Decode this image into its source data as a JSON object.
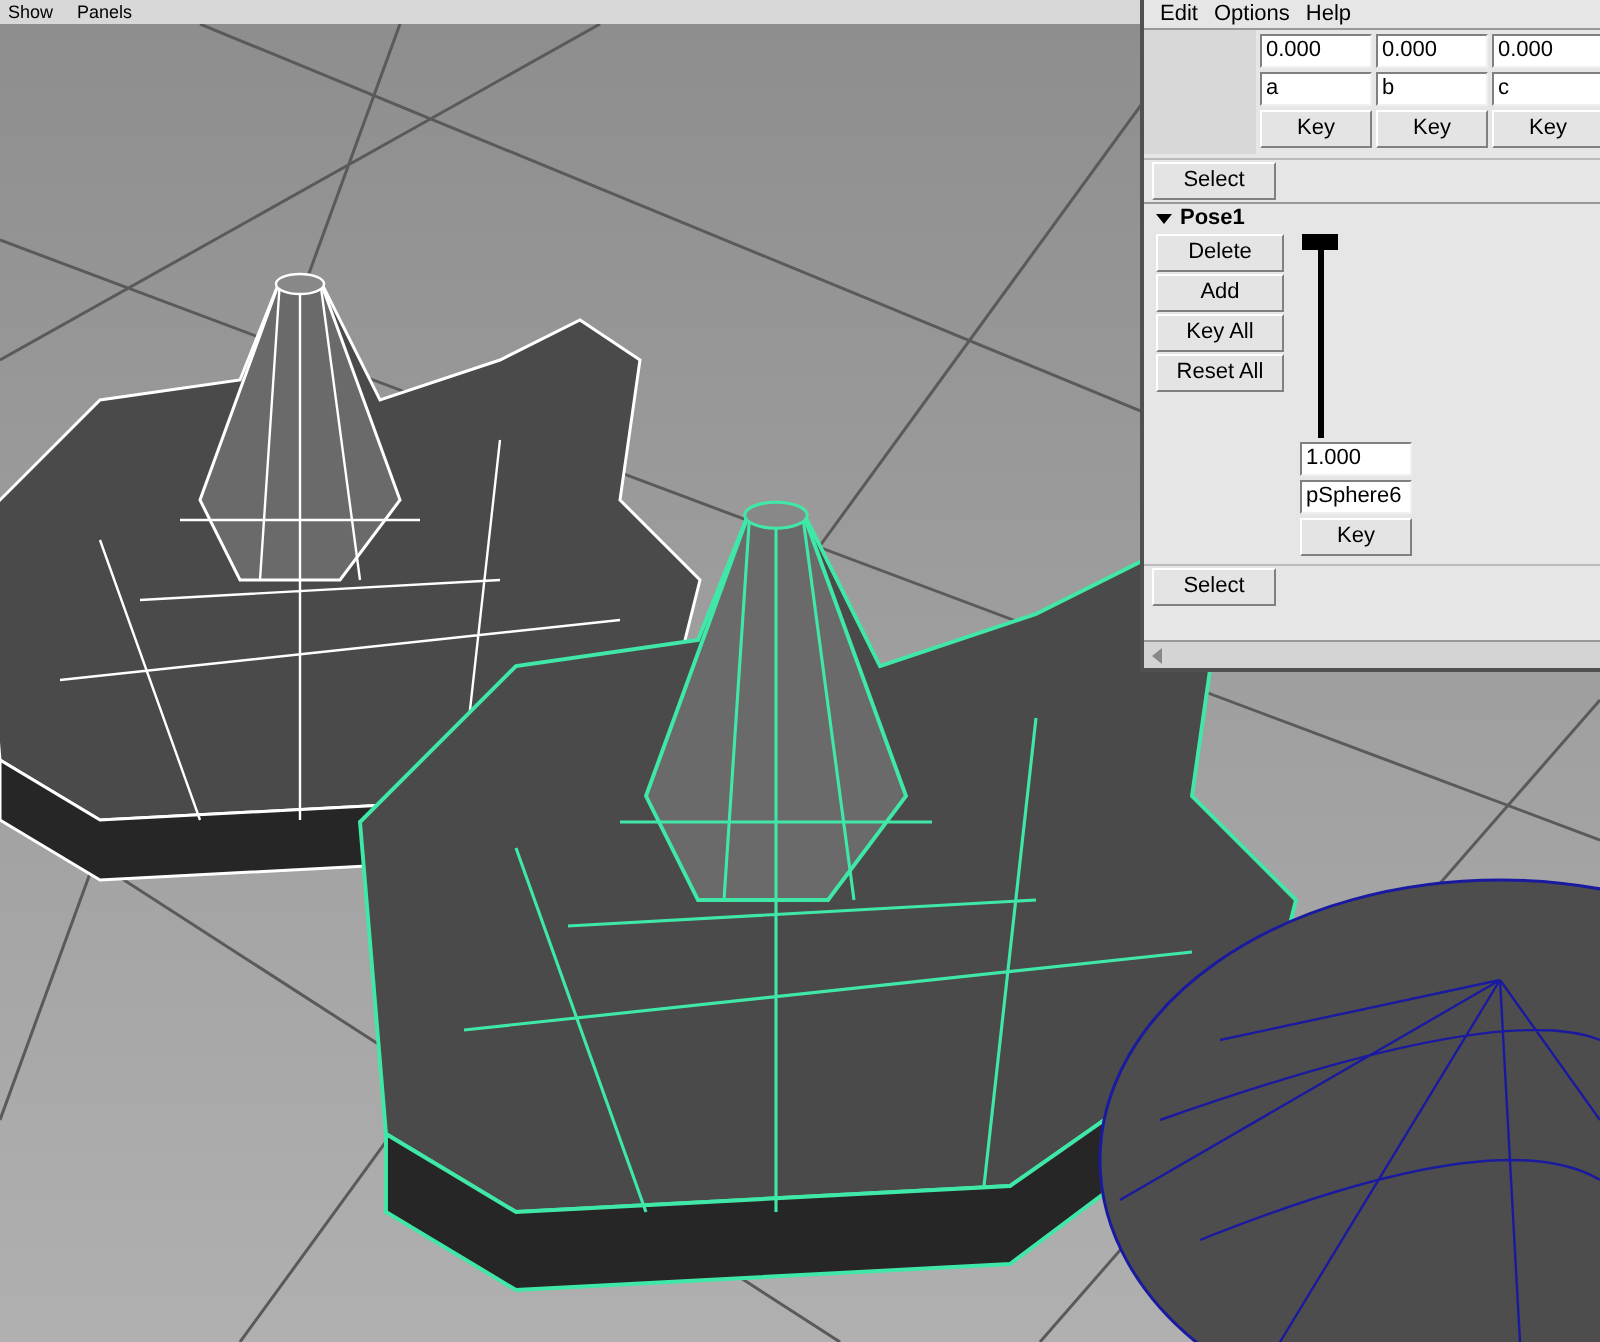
{
  "viewport": {
    "menu": [
      "Show",
      "Panels"
    ]
  },
  "blend_shape_window": {
    "menu": [
      "Edit",
      "Options",
      "Help"
    ],
    "targets": [
      {
        "weight": "0.000",
        "name": "a",
        "key_label": "Key"
      },
      {
        "weight": "0.000",
        "name": "b",
        "key_label": "Key"
      },
      {
        "weight": "0.000",
        "name": "c",
        "key_label": "Key"
      }
    ],
    "select_label": "Select",
    "pose": {
      "title": "Pose1",
      "expanded": true,
      "buttons": [
        "Delete",
        "Add",
        "Key All",
        "Reset All"
      ],
      "slider": {
        "level": 1
      },
      "weight": "1.000",
      "name": "pSphere6",
      "key_label": "Key",
      "select_label": "Select"
    }
  }
}
